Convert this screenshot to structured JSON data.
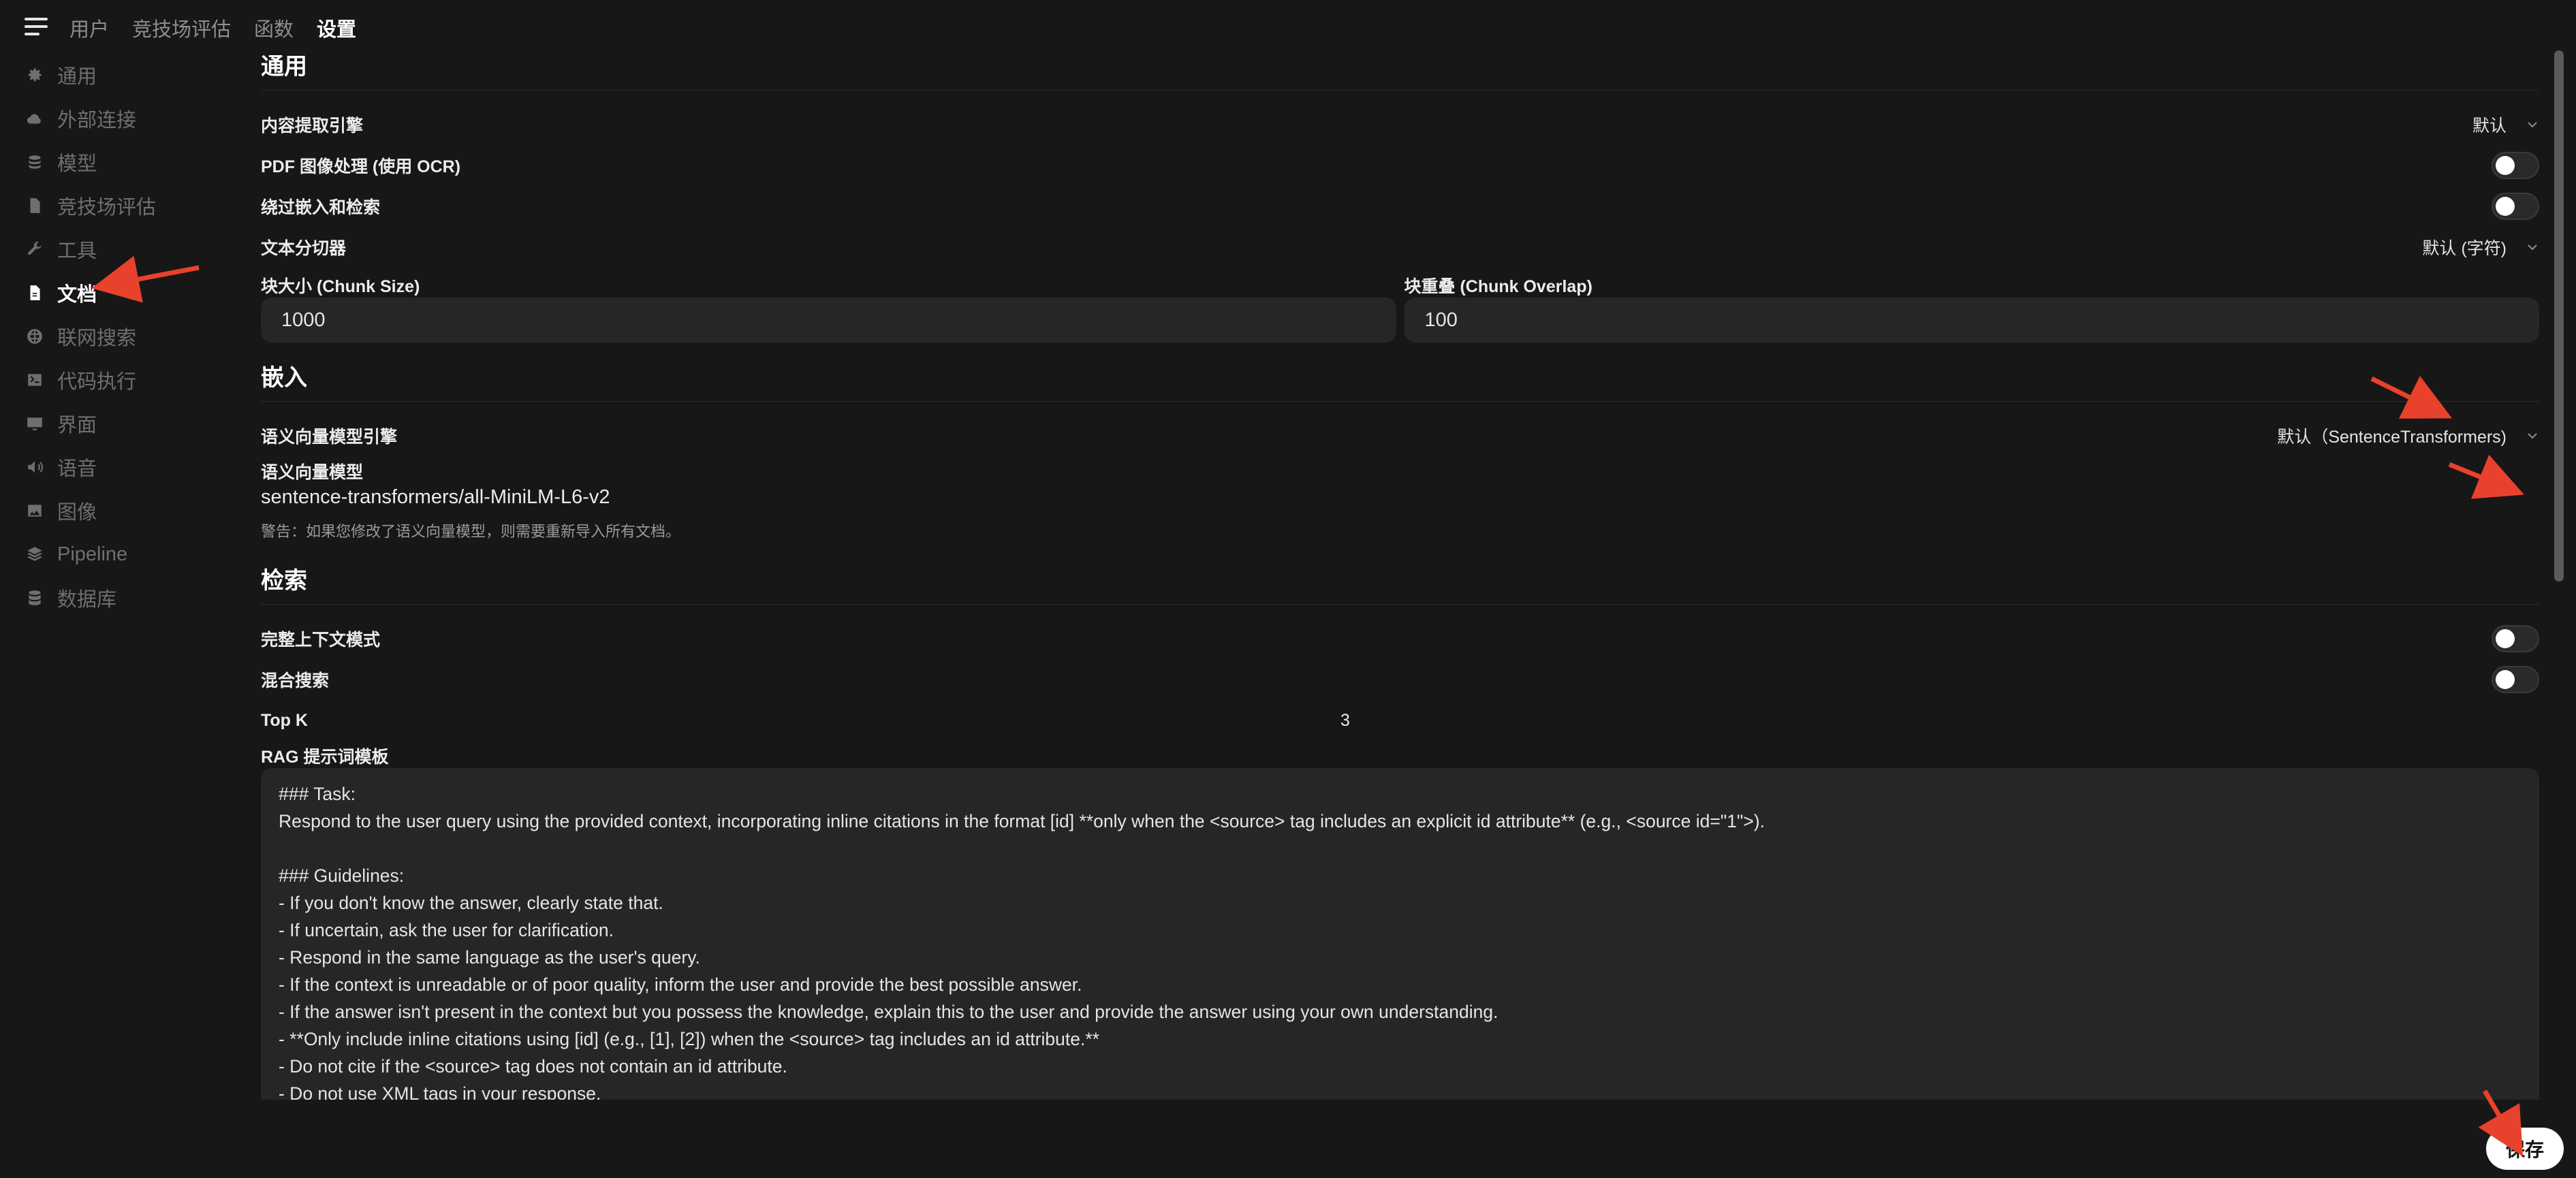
{
  "topnav": {
    "items": [
      {
        "label": "用户",
        "active": false
      },
      {
        "label": "竞技场评估",
        "active": false
      },
      {
        "label": "函数",
        "active": false
      },
      {
        "label": "设置",
        "active": true
      }
    ]
  },
  "sidebar": {
    "items": [
      {
        "label": "通用",
        "icon": "gear-icon"
      },
      {
        "label": "外部连接",
        "icon": "cloud-icon"
      },
      {
        "label": "模型",
        "icon": "stack-icon"
      },
      {
        "label": "竞技场评估",
        "icon": "document-icon"
      },
      {
        "label": "工具",
        "icon": "wrench-icon"
      },
      {
        "label": "文档",
        "icon": "document-text-icon",
        "active": true
      },
      {
        "label": "联网搜索",
        "icon": "globe-icon"
      },
      {
        "label": "代码执行",
        "icon": "terminal-icon"
      },
      {
        "label": "界面",
        "icon": "monitor-icon"
      },
      {
        "label": "语音",
        "icon": "speaker-icon"
      },
      {
        "label": "图像",
        "icon": "image-icon"
      },
      {
        "label": "Pipeline",
        "icon": "layers-icon"
      },
      {
        "label": "数据库",
        "icon": "database-icon"
      }
    ]
  },
  "general": {
    "title": "通用",
    "content_engine_label": "内容提取引擎",
    "content_engine_value": "默认",
    "pdf_ocr_label": "PDF 图像处理 (使用 OCR)",
    "bypass_label": "绕过嵌入和检索",
    "splitter_label": "文本分切器",
    "splitter_value": "默认 (字符)",
    "chunk_size_label": "块大小 (Chunk Size)",
    "chunk_size_value": "1000",
    "chunk_overlap_label": "块重叠 (Chunk Overlap)",
    "chunk_overlap_value": "100"
  },
  "embedding": {
    "title": "嵌入",
    "engine_label": "语义向量模型引擎",
    "engine_value": "默认（SentenceTransformers)",
    "model_label": "语义向量模型",
    "model_value": "sentence-transformers/all-MiniLM-L6-v2",
    "warning": "警告：如果您修改了语义向量模型，则需要重新导入所有文档。"
  },
  "retrieval": {
    "title": "检索",
    "full_context_label": "完整上下文模式",
    "hybrid_label": "混合搜索",
    "topk_label": "Top K",
    "topk_value": "3",
    "rag_label": "RAG 提示词模板",
    "rag_template": "### Task:\nRespond to the user query using the provided context, incorporating inline citations in the format [id] **only when the <source> tag includes an explicit id attribute** (e.g., <source id=\"1\">).\n\n### Guidelines:\n- If you don't know the answer, clearly state that.\n- If uncertain, ask the user for clarification.\n- Respond in the same language as the user's query.\n- If the context is unreadable or of poor quality, inform the user and provide the best possible answer.\n- If the answer isn't present in the context but you possess the knowledge, explain this to the user and provide the answer using your own understanding.\n- **Only include inline citations using [id] (e.g., [1], [2]) when the <source> tag includes an id attribute.**\n- Do not cite if the <source> tag does not contain an id attribute.\n- Do not use XML tags in your response."
  },
  "save_label": "保存",
  "colors": {
    "background": "#171717",
    "input_bg": "#262626",
    "annotation_arrow": "#e8412c"
  }
}
